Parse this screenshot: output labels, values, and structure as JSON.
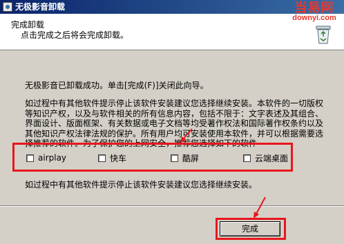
{
  "window": {
    "title": "无极影音卸载"
  },
  "watermark": {
    "line1": "当易网",
    "line2": "downyi.com"
  },
  "header": {
    "title": "完成卸载",
    "subtitle": "点击完成之后将会完成卸载。"
  },
  "body": {
    "success": "无极影音已卸载成功。单击[完成(F)]关闭此向导。",
    "notice_lines": [
      "如过程中有其他软件提示停止该软件安装建议您选择继续安装。本软件的一切版权",
      "等知识产权，以及与软件相关的所有信息内容，包括不限于：文字表述及其组合、",
      "界面设计、版面框架、有关数据或电子文档等均受著作权法和国际著作权条约以及",
      "其他知识产权法律法规的保护。所有用户均可安装使用本软件，并可以根据需要选",
      "择推荐的软件。为了保护您的上网安全，推荐您选择如下的软件"
    ],
    "bottom_notice": "如过程中有其他软件提示停止该软件安装建议您选择继续安装。"
  },
  "options": [
    {
      "label": "airplay",
      "checked": false
    },
    {
      "label": "快车",
      "checked": false
    },
    {
      "label": "酷屏",
      "checked": false
    },
    {
      "label": "云端桌面",
      "checked": false
    }
  ],
  "buttons": {
    "finish": "完成"
  },
  "colors": {
    "highlight": "#e8161c",
    "titlebar": "#0a246a",
    "dialog": "#d4d0c8"
  }
}
